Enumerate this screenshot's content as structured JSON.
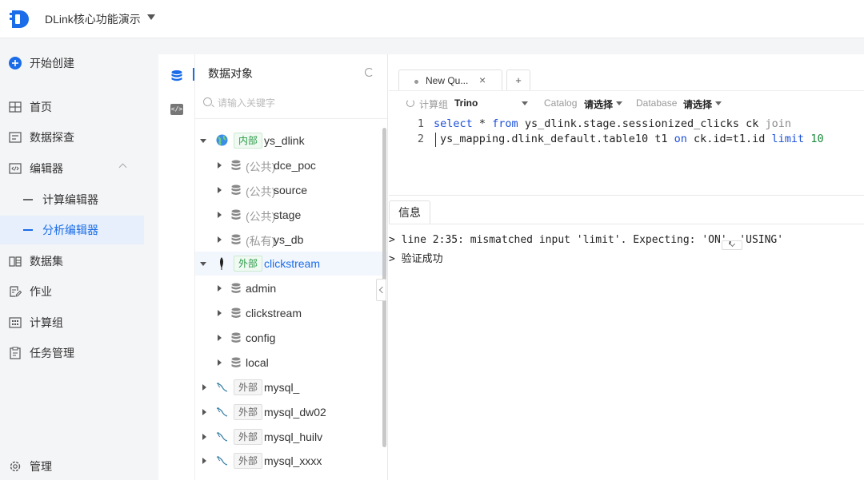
{
  "app": {
    "title": "DLink核心功能演示"
  },
  "nav": {
    "create": "开始创建",
    "items": [
      {
        "label": "首页"
      },
      {
        "label": "数据探查"
      },
      {
        "label": "编辑器"
      },
      {
        "label": "计算编辑器"
      },
      {
        "label": "分析编辑器"
      },
      {
        "label": "数据集"
      },
      {
        "label": "作业"
      },
      {
        "label": "计算组"
      },
      {
        "label": "任务管理"
      }
    ],
    "manage": "管理"
  },
  "tree": {
    "title": "数据对象",
    "search_placeholder": "请输入关键字",
    "rows": [
      {
        "badge": "内部",
        "name": "ys_dlink"
      },
      {
        "scope": "(公共)",
        "name": "dce_poc"
      },
      {
        "scope": "(公共)",
        "name": "source"
      },
      {
        "scope": "(公共)",
        "name": "stage"
      },
      {
        "scope": "(私有)",
        "name": "ys_db"
      },
      {
        "badge": "外部",
        "name": "clickstream"
      },
      {
        "name": "admin"
      },
      {
        "name": "clickstream"
      },
      {
        "name": "config"
      },
      {
        "name": "local"
      },
      {
        "badge": "外部",
        "name": "mysql_"
      },
      {
        "badge": "外部",
        "name": "mysql_dw02"
      },
      {
        "badge": "外部",
        "name": "mysql_huilv"
      },
      {
        "badge": "外部",
        "name": "mysql_xxxx"
      }
    ]
  },
  "editor": {
    "tab_name": "New Qu...",
    "tab_close": "×",
    "tab_add": "+",
    "toolbar": {
      "compute_label": "计算组",
      "compute_value": "Trino",
      "catalog_label": "Catalog",
      "catalog_value": "请选择",
      "database_label": "Database",
      "database_value": "请选择"
    },
    "line_numbers": [
      "1",
      "2"
    ],
    "code": {
      "l1_kw1": "select",
      "l1_t1": " * ",
      "l1_kw2": "from",
      "l1_t2": " ys_dlink.stage.sessionized_clicks ck ",
      "l1_kw3": "join",
      "l2_t1": "ys_mapping.dlink_default.table10 t1 ",
      "l2_kw1": "on",
      "l2_t2": " ck.id=t1.id ",
      "l2_kw2": "limit",
      "l2_num": " 10"
    }
  },
  "info": {
    "tab": "信息",
    "lines": [
      "> line 2:35: mismatched input 'limit'. Expecting: 'ON', 'USING'",
      "> 验证成功"
    ]
  },
  "colors": {
    "accent": "#1a6ce8",
    "green": "#2a9a48"
  }
}
